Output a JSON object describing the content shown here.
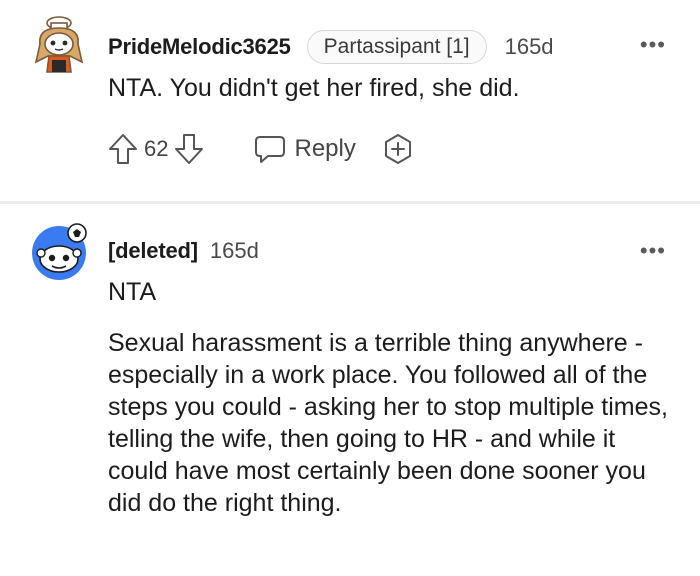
{
  "comments": [
    {
      "username": "PrideMelodic3625",
      "flair": "Partassipant [1]",
      "age": "165d",
      "body": [
        "NTA. You didn't get her fired, she did."
      ],
      "votes": "62",
      "reply_label": "Reply",
      "avatar_icon": "snoo-chef-avatar"
    },
    {
      "username": "[deleted]",
      "age": "165d",
      "body": [
        "NTA",
        "Sexual harassment is a terrible thing anywhere - especially in a work place. You followed all of the steps you could - asking her to stop multiple times, telling the wife, then going to HR - and while it could have most certainly been done sooner you did do the right thing."
      ],
      "avatar_icon": "deleted-snoo-avatar"
    }
  ],
  "more_icon": "more-options-icon",
  "colors": {
    "text": "#1c1c1c",
    "muted": "#4a4a4a",
    "divider": "#ececec",
    "avatar_blue": "#3a7bf2"
  }
}
